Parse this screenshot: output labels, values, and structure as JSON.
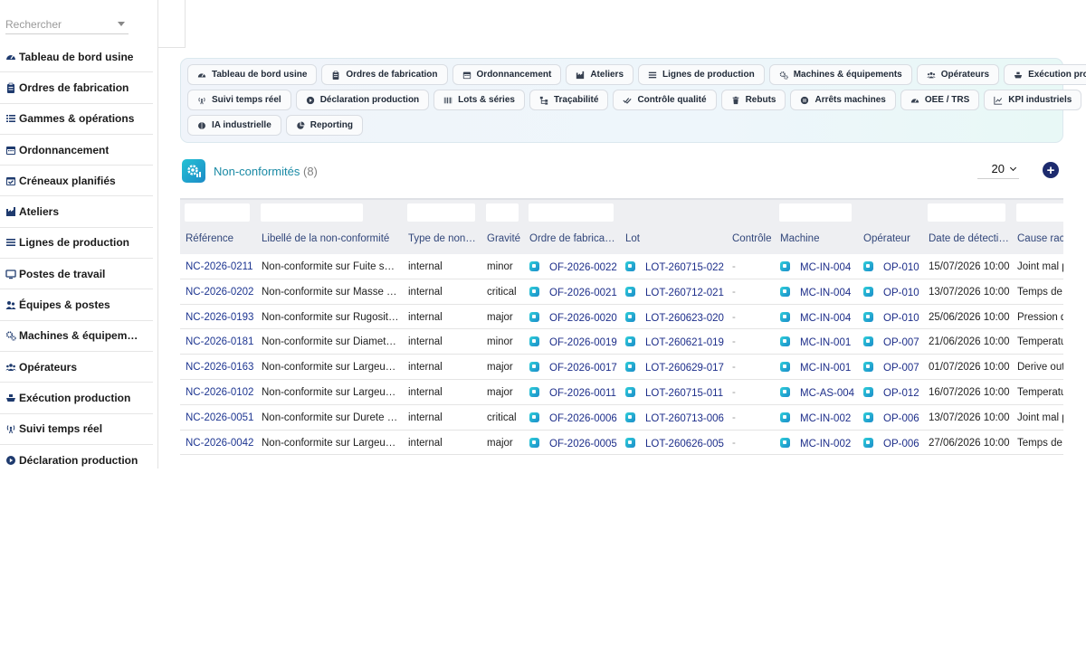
{
  "search": {
    "placeholder": "Rechercher"
  },
  "sidebar": {
    "items": [
      {
        "label": "Tableau de bord usine",
        "icon": "gauge-icon"
      },
      {
        "label": "Ordres de fabrication",
        "icon": "clipboard-icon"
      },
      {
        "label": "Gammes & opérations",
        "icon": "list-icon"
      },
      {
        "label": "Ordonnancement",
        "icon": "calendar-icon"
      },
      {
        "label": "Créneaux planifiés",
        "icon": "calendar-check-icon"
      },
      {
        "label": "Ateliers",
        "icon": "industry-icon"
      },
      {
        "label": "Lignes de production",
        "icon": "lines-icon"
      },
      {
        "label": "Postes de travail",
        "icon": "monitor-icon"
      },
      {
        "label": "Équipes & postes",
        "icon": "user-group-icon"
      },
      {
        "label": "Machines & équipem…",
        "icon": "gears-icon"
      },
      {
        "label": "Opérateurs",
        "icon": "users-icon"
      },
      {
        "label": "Exécution production",
        "icon": "ship-icon"
      },
      {
        "label": "Suivi temps réel",
        "icon": "broadcast-icon"
      },
      {
        "label": "Déclaration production",
        "icon": "play-circle-icon"
      }
    ]
  },
  "nav_chips": {
    "row1": [
      {
        "label": "Tableau de bord usine",
        "icon": "gauge-icon"
      },
      {
        "label": "Ordres de fabrication",
        "icon": "clipboard-icon"
      },
      {
        "label": "Ordonnancement",
        "icon": "calendar-icon"
      },
      {
        "label": "Ateliers",
        "icon": "industry-icon"
      },
      {
        "label": "Lignes de production",
        "icon": "lines-icon"
      },
      {
        "label": "Machines & équipements",
        "icon": "gears-icon"
      },
      {
        "label": "Opérateurs",
        "icon": "users-icon"
      },
      {
        "label": "Exécution production",
        "icon": "ship-icon"
      }
    ],
    "row2": [
      {
        "label": "Suivi temps réel",
        "icon": "broadcast-icon"
      },
      {
        "label": "Déclaration production",
        "icon": "play-circle-icon"
      },
      {
        "label": "Lots & séries",
        "icon": "barcode-icon"
      },
      {
        "label": "Traçabilité",
        "icon": "sitemap-icon"
      },
      {
        "label": "Contrôle qualité",
        "icon": "check-double-icon"
      },
      {
        "label": "Rebuts",
        "icon": "trash-icon"
      },
      {
        "label": "Arrêts machines",
        "icon": "pause-circle-icon"
      },
      {
        "label": "OEE / TRS",
        "icon": "gauge-icon"
      },
      {
        "label": "KPI industriels",
        "icon": "line-chart-icon"
      }
    ],
    "row3": [
      {
        "label": "IA industrielle",
        "icon": "brain-icon"
      },
      {
        "label": "Reporting",
        "icon": "pie-chart-icon"
      }
    ]
  },
  "list": {
    "title": "Non-conformités",
    "count": "(8)",
    "page_size": "20",
    "add_label": "+"
  },
  "table": {
    "columns": [
      "Référence",
      "Libellé de la non-conformité",
      "Type de non…",
      "Gravité",
      "Ordre de fabrica…",
      "Lot",
      "Contrôle",
      "Machine",
      "Opérateur",
      "Date de détecti…",
      "Cause raci"
    ],
    "rows": [
      {
        "ref": "NC-2026-0211",
        "label": "Non-conformite sur Fuite so…",
        "type": "internal",
        "severity": "minor",
        "of": "OF-2026-0022",
        "lot": "LOT-260715-022",
        "control": "-",
        "machine": "MC-IN-004",
        "operator": "OP-010",
        "date": "15/07/2026 10:00",
        "cause": "Joint mal p"
      },
      {
        "ref": "NC-2026-0202",
        "label": "Non-conformite sur Masse p…",
        "type": "internal",
        "severity": "critical",
        "of": "OF-2026-0021",
        "lot": "LOT-260712-021",
        "control": "-",
        "machine": "MC-IN-004",
        "operator": "OP-010",
        "date": "13/07/2026 10:00",
        "cause": "Temps de"
      },
      {
        "ref": "NC-2026-0193",
        "label": "Non-conformite sur Rugosit…",
        "type": "internal",
        "severity": "major",
        "of": "OF-2026-0020",
        "lot": "LOT-260623-020",
        "control": "-",
        "machine": "MC-IN-004",
        "operator": "OP-010",
        "date": "25/06/2026 10:00",
        "cause": "Pression d"
      },
      {
        "ref": "NC-2026-0181",
        "label": "Non-conformite sur Diametr…",
        "type": "internal",
        "severity": "minor",
        "of": "OF-2026-0019",
        "lot": "LOT-260621-019",
        "control": "-",
        "machine": "MC-IN-001",
        "operator": "OP-007",
        "date": "21/06/2026 10:00",
        "cause": "Temperatu"
      },
      {
        "ref": "NC-2026-0163",
        "label": "Non-conformite sur Largeur …",
        "type": "internal",
        "severity": "major",
        "of": "OF-2026-0017",
        "lot": "LOT-260629-017",
        "control": "-",
        "machine": "MC-IN-001",
        "operator": "OP-007",
        "date": "01/07/2026 10:00",
        "cause": "Derive out"
      },
      {
        "ref": "NC-2026-0102",
        "label": "Non-conformite sur Largeur …",
        "type": "internal",
        "severity": "major",
        "of": "OF-2026-0011",
        "lot": "LOT-260715-011",
        "control": "-",
        "machine": "MC-AS-004",
        "operator": "OP-012",
        "date": "16/07/2026 10:00",
        "cause": "Temperatu"
      },
      {
        "ref": "NC-2026-0051",
        "label": "Non-conformite sur Durete …",
        "type": "internal",
        "severity": "critical",
        "of": "OF-2026-0006",
        "lot": "LOT-260713-006",
        "control": "-",
        "machine": "MC-IN-002",
        "operator": "OP-006",
        "date": "13/07/2026 10:00",
        "cause": "Joint mal p"
      },
      {
        "ref": "NC-2026-0042",
        "label": "Non-conformite sur Largeur …",
        "type": "internal",
        "severity": "major",
        "of": "OF-2026-0005",
        "lot": "LOT-260626-005",
        "control": "-",
        "machine": "MC-IN-002",
        "operator": "OP-006",
        "date": "27/06/2026 10:00",
        "cause": "Temps de"
      }
    ]
  },
  "colors": {
    "accent": "#1a8aa5",
    "link": "#1d2e8a",
    "add_button": "#1d2b6e"
  }
}
